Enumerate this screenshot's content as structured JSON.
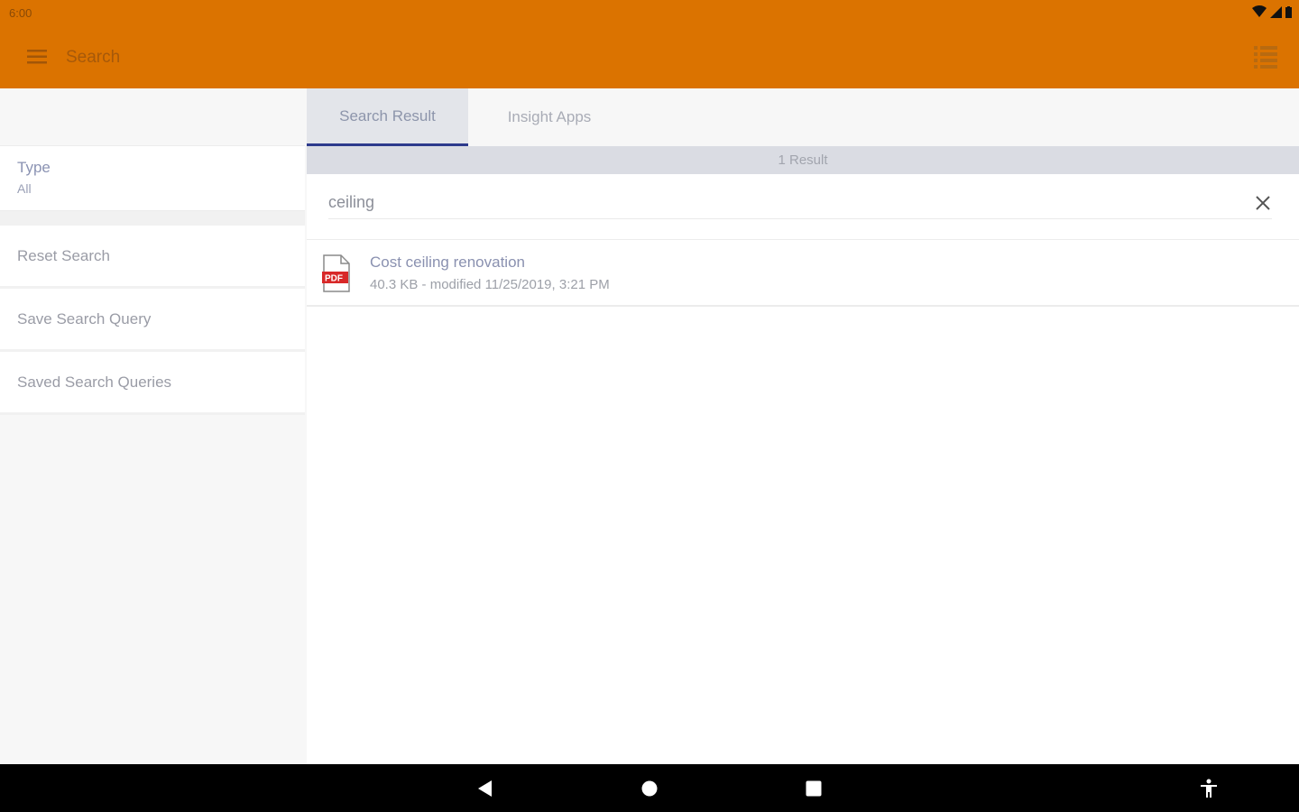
{
  "status": {
    "time": "6:00"
  },
  "appbar": {
    "title": "Search"
  },
  "sidebar": {
    "type_label": "Type",
    "type_value": "All",
    "items": [
      {
        "label": "Reset Search"
      },
      {
        "label": "Save Search Query"
      },
      {
        "label": "Saved Search Queries"
      }
    ]
  },
  "tabs": [
    {
      "label": "Search Result",
      "active": true
    },
    {
      "label": "Insight Apps",
      "active": false
    }
  ],
  "results": {
    "count_text": "1 Result",
    "search_value": "ceiling",
    "items": [
      {
        "title": "Cost ceiling renovation",
        "meta": "40.3 KB - modified 11/25/2019, 3:21 PM",
        "icon": "pdf-file-icon"
      }
    ]
  },
  "colors": {
    "appbar": "#db7300",
    "tab_indicator": "#2d3a8c",
    "navbar": "#000000"
  }
}
